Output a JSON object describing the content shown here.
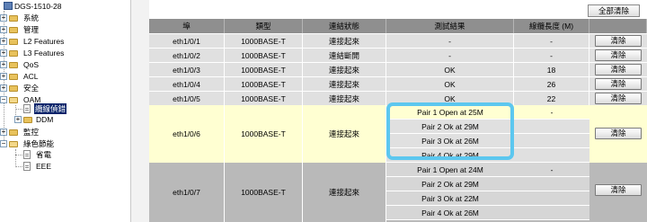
{
  "tree": {
    "root": "DGS-1510-28",
    "items": [
      "系統",
      "管理",
      "L2 Features",
      "L3 Features",
      "QoS",
      "ACL",
      "安全",
      "OAM",
      "纜線偵錯",
      "DDM",
      "監控",
      "綠色節能",
      "省電",
      "EEE"
    ]
  },
  "toolbar": {
    "clear_all": "全部清除"
  },
  "table": {
    "headers": [
      "埠",
      "類型",
      "連結狀態",
      "測試結果",
      "線纜長度 (M)",
      ""
    ],
    "clear_label": "清除",
    "rows": [
      {
        "port": "eth1/0/1",
        "type": "1000BASE-T",
        "link": "連接起來",
        "result": "-",
        "length": "-"
      },
      {
        "port": "eth1/0/2",
        "type": "1000BASE-T",
        "link": "連結斷開",
        "result": "-",
        "length": "-"
      },
      {
        "port": "eth1/0/3",
        "type": "1000BASE-T",
        "link": "連接起來",
        "result": "OK",
        "length": "18"
      },
      {
        "port": "eth1/0/4",
        "type": "1000BASE-T",
        "link": "連接起來",
        "result": "OK",
        "length": "26"
      },
      {
        "port": "eth1/0/5",
        "type": "1000BASE-T",
        "link": "連接起來",
        "result": "OK",
        "length": "22"
      }
    ],
    "expanded_rows": [
      {
        "port": "eth1/0/6",
        "type": "1000BASE-T",
        "link": "連接起來",
        "pairs": [
          "Pair 1 Open at 25M",
          "Pair 2 Ok at 29M",
          "Pair 3 Ok at 26M",
          "Pair 4 Ok at 29M"
        ],
        "length": "-"
      },
      {
        "port": "eth1/0/7",
        "type": "1000BASE-T",
        "link": "連接起來",
        "pairs": [
          "Pair 1 Open at 24M",
          "Pair 2 Ok at 29M",
          "Pair 3 Ok at 22M",
          "Pair 4 Ok at 26M"
        ],
        "length": "-"
      }
    ]
  },
  "colors": {
    "highlight": "#5cc7ef",
    "selected_row": "#ffffd2",
    "header": "#8f8f8f"
  }
}
